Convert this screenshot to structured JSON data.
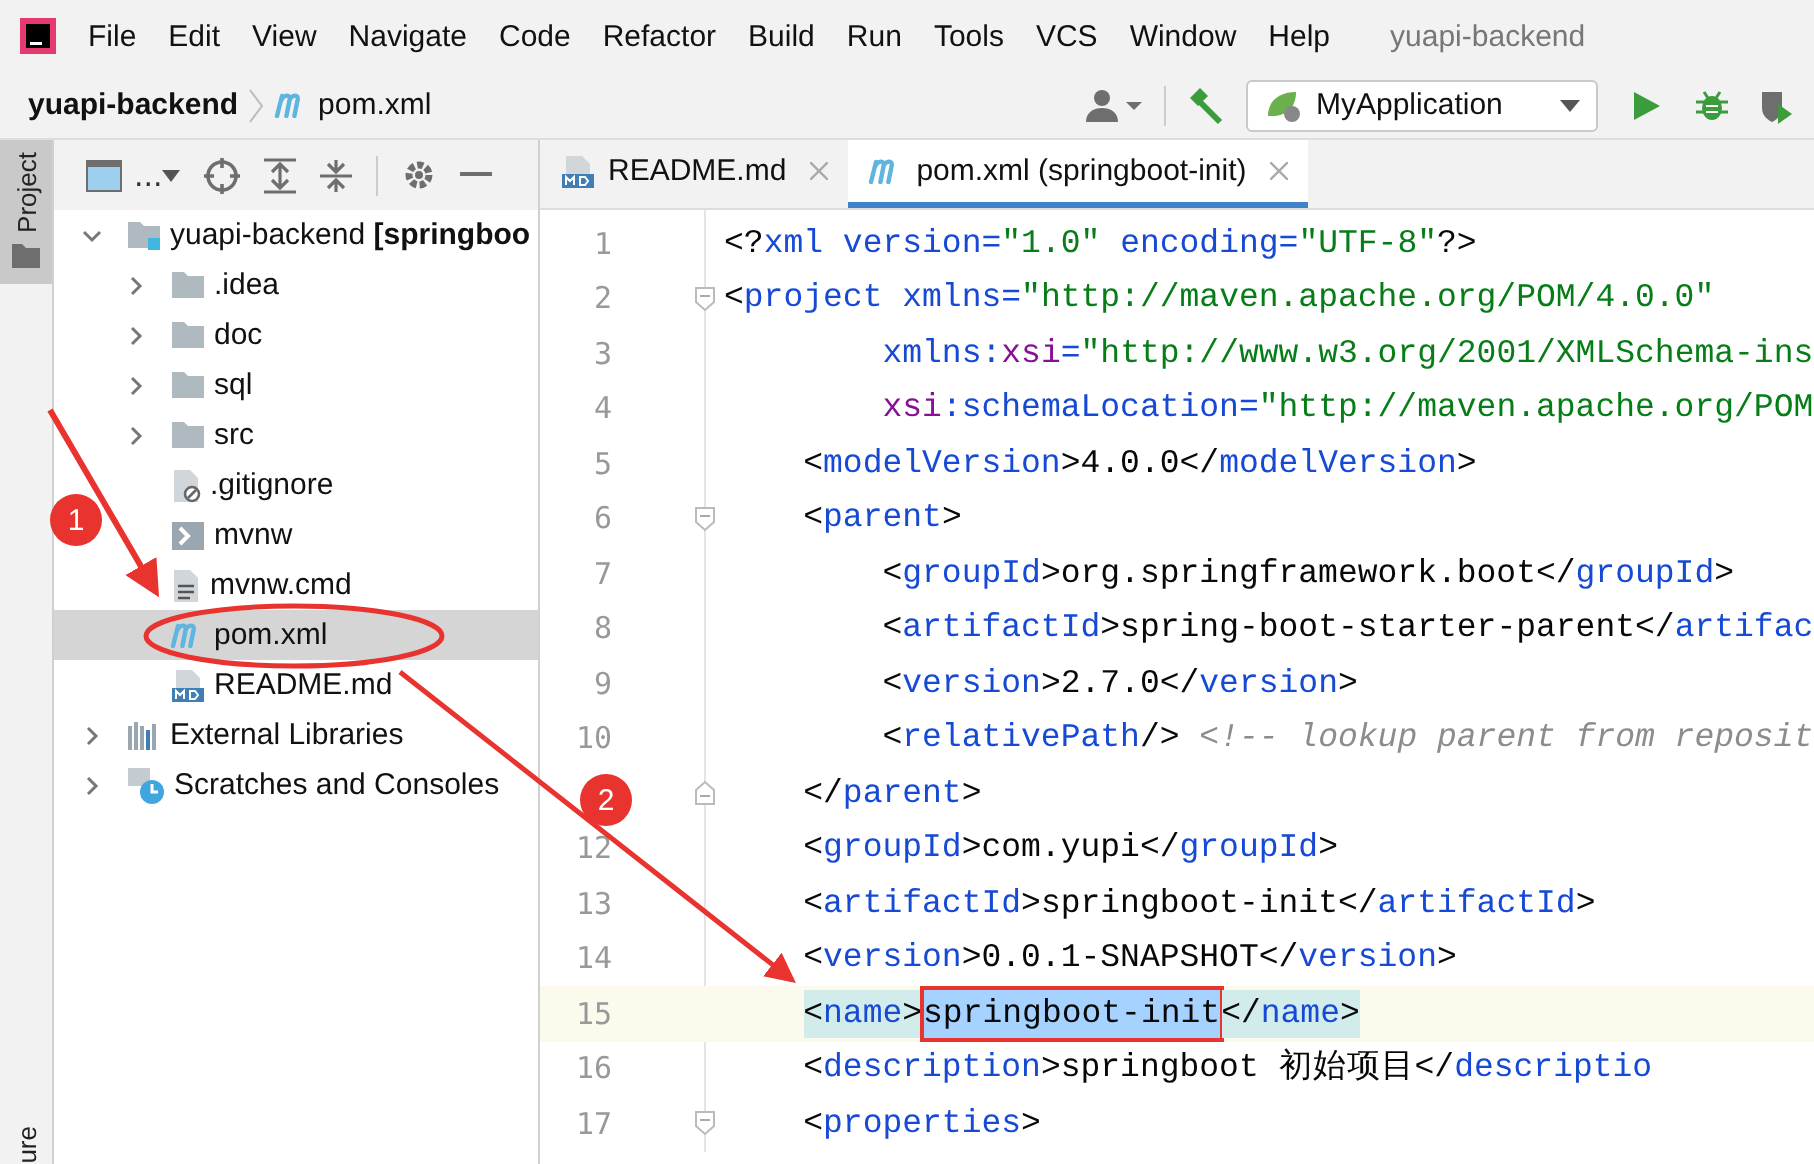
{
  "menu_bar": {
    "items": [
      "File",
      "Edit",
      "View",
      "Navigate",
      "Code",
      "Refactor",
      "Build",
      "Run",
      "Tools",
      "VCS",
      "Window",
      "Help"
    ],
    "title": "yuapi-backend"
  },
  "nav_bar": {
    "breadcrumbs": [
      "yuapi-backend",
      "pom.xml"
    ],
    "run_config": "MyApplication"
  },
  "side_strip": {
    "top_tab": {
      "label": "Project",
      "selected": true
    },
    "bottom_tab": {
      "label": "ure",
      "selected": false
    }
  },
  "project_panel": {
    "view_label": "...",
    "tree": [
      {
        "label": "yuapi-backend **[springboo**",
        "kind": "module",
        "expanded": true,
        "selected": false,
        "children": [
          {
            "label": ".idea",
            "kind": "folder",
            "expanded": false,
            "selected": false
          },
          {
            "label": "doc",
            "kind": "folder",
            "expanded": false,
            "selected": false
          },
          {
            "label": "sql",
            "kind": "folder",
            "expanded": false,
            "selected": false
          },
          {
            "label": "src",
            "kind": "folder",
            "expanded": false,
            "selected": false
          },
          {
            "label": ".gitignore",
            "kind": "ignore",
            "selected": false
          },
          {
            "label": "mvnw",
            "kind": "script",
            "selected": false
          },
          {
            "label": "mvnw.cmd",
            "kind": "text",
            "selected": false
          },
          {
            "label": "pom.xml",
            "kind": "maven",
            "selected": true
          },
          {
            "label": "README.md",
            "kind": "markdown",
            "selected": false
          }
        ]
      },
      {
        "label": "External Libraries",
        "kind": "libraries",
        "expanded": false,
        "selected": false
      },
      {
        "label": "Scratches and Consoles",
        "kind": "scratches",
        "expanded": false,
        "selected": false
      }
    ]
  },
  "editor": {
    "tabs": [
      {
        "label": "README.md",
        "kind": "markdown",
        "selected": false
      },
      {
        "label": "pom.xml (springboot-init)",
        "kind": "maven",
        "selected": true
      }
    ],
    "lines": [
      {
        "number": "1",
        "kind": "plain",
        "current": false,
        "tokens": [
          {
            "text": "<?",
            "kind": "punct"
          },
          {
            "text": "xml ",
            "kind": "tag"
          },
          {
            "text": "version=",
            "kind": "attr"
          },
          {
            "text": "\"1.0\" ",
            "kind": "value"
          },
          {
            "text": "encoding=",
            "kind": "attr"
          },
          {
            "text": "\"UTF-8\"",
            "kind": "value"
          },
          {
            "text": "?>",
            "kind": "punct"
          }
        ]
      },
      {
        "number": "2",
        "kind": "fold-start",
        "current": false,
        "tokens": [
          {
            "text": "<",
            "kind": "punct"
          },
          {
            "text": "project ",
            "kind": "tag"
          },
          {
            "text": "xmlns=",
            "kind": "attr"
          },
          {
            "text": "\"http://maven.apache.org/POM/4.0.0\"",
            "kind": "value"
          }
        ]
      },
      {
        "number": "3",
        "kind": "plain",
        "current": false,
        "tokens": [
          {
            "text": "        xmlns:",
            "kind": "attr"
          },
          {
            "text": "xsi",
            "kind": "ns"
          },
          {
            "text": "=",
            "kind": "attr"
          },
          {
            "text": "\"http://www.w3.org/2001/XMLSchema-ins",
            "kind": "value"
          }
        ]
      },
      {
        "number": "4",
        "kind": "plain",
        "current": false,
        "tokens": [
          {
            "text": "        xsi",
            "kind": "ns"
          },
          {
            "text": ":schemaLocation=",
            "kind": "attr"
          },
          {
            "text": "\"http://maven.apache.org/POM",
            "kind": "value"
          }
        ]
      },
      {
        "number": "5",
        "kind": "plain",
        "current": false,
        "tokens": [
          {
            "text": "    <",
            "kind": "punct"
          },
          {
            "text": "modelVersion",
            "kind": "tag"
          },
          {
            "text": ">4.0.0</",
            "kind": "punct"
          },
          {
            "text": "modelVersion",
            "kind": "tag"
          },
          {
            "text": ">",
            "kind": "punct"
          }
        ]
      },
      {
        "number": "6",
        "kind": "fold-start",
        "current": false,
        "tokens": [
          {
            "text": "    <",
            "kind": "punct"
          },
          {
            "text": "parent",
            "kind": "tag"
          },
          {
            "text": ">",
            "kind": "punct"
          }
        ]
      },
      {
        "number": "7",
        "kind": "plain",
        "current": false,
        "tokens": [
          {
            "text": "        <",
            "kind": "punct"
          },
          {
            "text": "groupId",
            "kind": "tag"
          },
          {
            "text": ">org.springframework.boot</",
            "kind": "punct"
          },
          {
            "text": "groupId",
            "kind": "tag"
          },
          {
            "text": ">",
            "kind": "punct"
          }
        ]
      },
      {
        "number": "8",
        "kind": "plain",
        "current": false,
        "tokens": [
          {
            "text": "        <",
            "kind": "punct"
          },
          {
            "text": "artifactId",
            "kind": "tag"
          },
          {
            "text": ">spring-boot-starter-parent</",
            "kind": "punct"
          },
          {
            "text": "artifac",
            "kind": "tag"
          }
        ]
      },
      {
        "number": "9",
        "kind": "plain",
        "current": false,
        "tokens": [
          {
            "text": "        <",
            "kind": "punct"
          },
          {
            "text": "version",
            "kind": "tag"
          },
          {
            "text": ">2.7.0</",
            "kind": "punct"
          },
          {
            "text": "version",
            "kind": "tag"
          },
          {
            "text": ">",
            "kind": "punct"
          }
        ]
      },
      {
        "number": "10",
        "kind": "plain",
        "current": false,
        "tokens": [
          {
            "text": "        <",
            "kind": "punct"
          },
          {
            "text": "relativePath",
            "kind": "tag"
          },
          {
            "text": "/> ",
            "kind": "punct"
          },
          {
            "text": "<!-- lookup parent from reposit",
            "kind": "comment"
          }
        ]
      },
      {
        "kind": "fold-end",
        "current": false,
        "tokens": [
          {
            "text": "    </",
            "kind": "punct"
          },
          {
            "text": "parent",
            "kind": "tag"
          },
          {
            "text": ">",
            "kind": "punct"
          }
        ]
      },
      {
        "number": "12",
        "kind": "plain",
        "current": false,
        "tokens": [
          {
            "text": "    <",
            "kind": "punct"
          },
          {
            "text": "groupId",
            "kind": "tag"
          },
          {
            "text": ">com.yupi</",
            "kind": "punct"
          },
          {
            "text": "groupId",
            "kind": "tag"
          },
          {
            "text": ">",
            "kind": "punct"
          }
        ]
      },
      {
        "number": "13",
        "kind": "plain",
        "current": false,
        "tokens": [
          {
            "text": "    <",
            "kind": "punct"
          },
          {
            "text": "artifactId",
            "kind": "tag"
          },
          {
            "text": ">springboot-init</",
            "kind": "punct"
          },
          {
            "text": "artifactId",
            "kind": "tag"
          },
          {
            "text": ">",
            "kind": "punct"
          }
        ]
      },
      {
        "number": "14",
        "kind": "plain",
        "current": false,
        "tokens": [
          {
            "text": "    <",
            "kind": "punct"
          },
          {
            "text": "version",
            "kind": "tag"
          },
          {
            "text": ">0.0.1-SNAPSHOT</",
            "kind": "punct"
          },
          {
            "text": "version",
            "kind": "tag"
          },
          {
            "text": ">",
            "kind": "punct"
          }
        ]
      },
      {
        "number": "15",
        "kind": "plain",
        "current": true,
        "tokens": [
          {
            "text": "    <",
            "kind": "match"
          },
          {
            "text": "name",
            "kind": "match-tag"
          },
          {
            "text": ">",
            "kind": "match"
          },
          {
            "text": "springboot-init",
            "kind": "selection"
          },
          {
            "text": "</",
            "kind": "match"
          },
          {
            "text": "name",
            "kind": "match-tag"
          },
          {
            "text": ">",
            "kind": "match"
          }
        ]
      },
      {
        "number": "16",
        "kind": "plain",
        "current": false,
        "tokens": [
          {
            "text": "    <",
            "kind": "punct"
          },
          {
            "text": "description",
            "kind": "tag"
          },
          {
            "text": ">springboot 初始项目</",
            "kind": "punct"
          },
          {
            "text": "descriptio",
            "kind": "tag"
          }
        ]
      },
      {
        "number": "17",
        "kind": "fold-start",
        "current": false,
        "tokens": [
          {
            "text": "    <",
            "kind": "punct"
          },
          {
            "text": "properties",
            "kind": "tag"
          },
          {
            "text": ">",
            "kind": "punct"
          }
        ]
      }
    ]
  },
  "annotations": {
    "badges": [
      "1",
      "2"
    ]
  }
}
